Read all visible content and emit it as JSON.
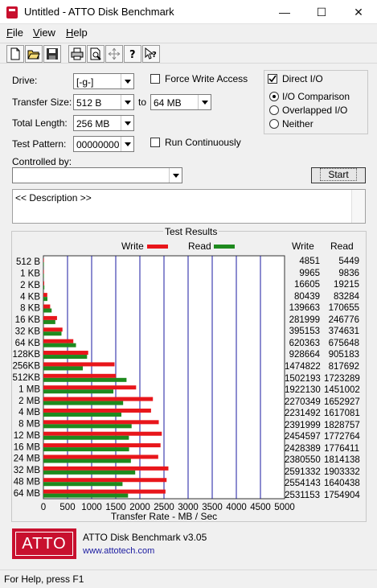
{
  "window": {
    "title": "Untitled - ATTO Disk Benchmark"
  },
  "titlebar_buttons": {
    "minimize": "—",
    "maximize": "☐",
    "close": "✕"
  },
  "menu": [
    "File",
    "View",
    "Help"
  ],
  "toolbar": [
    "new-file-icon",
    "open-folder-icon",
    "save-icon",
    "print-icon",
    "print-preview-icon",
    "move-icon",
    "help-icon",
    "context-help-icon"
  ],
  "settings": {
    "drive_label": "Drive:",
    "drive_value": "[-g-]",
    "transfer_size_label": "Transfer Size:",
    "transfer_from": "512 B",
    "to_label": "to",
    "transfer_to": "64 MB",
    "total_length_label": "Total Length:",
    "total_length_value": "256 MB",
    "test_pattern_label": "Test Pattern:",
    "test_pattern_value": "00000000",
    "controlled_by_label": "Controlled by:",
    "controlled_by_value": "",
    "force_write_access": "Force Write Access",
    "run_continuously": "Run Continuously",
    "direct_io": "Direct I/O",
    "io_comparison": "I/O Comparison",
    "overlapped_io": "Overlapped I/O",
    "neither": "Neither",
    "start_button": "Start",
    "description": "<< Description >>"
  },
  "results": {
    "title": "Test Results",
    "write_label": "Write",
    "read_label": "Read",
    "col_write": "Write",
    "col_read": "Read",
    "rows": [
      {
        "size": "512 B",
        "write": "4851",
        "read": "5449"
      },
      {
        "size": "1 KB",
        "write": "9965",
        "read": "9836"
      },
      {
        "size": "2 KB",
        "write": "16605",
        "read": "19215"
      },
      {
        "size": "4 KB",
        "write": "80439",
        "read": "83284"
      },
      {
        "size": "8 KB",
        "write": "139663",
        "read": "170655"
      },
      {
        "size": "16 KB",
        "write": "281999",
        "read": "246776"
      },
      {
        "size": "32 KB",
        "write": "395153",
        "read": "374631"
      },
      {
        "size": "64 KB",
        "write": "620363",
        "read": "675648"
      },
      {
        "size": "128KB",
        "write": "928664",
        "read": "905183"
      },
      {
        "size": "256KB",
        "write": "1474822",
        "read": "817692"
      },
      {
        "size": "512KB",
        "write": "1502193",
        "read": "1723289"
      },
      {
        "size": "1 MB",
        "write": "1922130",
        "read": "1451002"
      },
      {
        "size": "2 MB",
        "write": "2270349",
        "read": "1652927"
      },
      {
        "size": "4 MB",
        "write": "2231492",
        "read": "1617081"
      },
      {
        "size": "8 MB",
        "write": "2391999",
        "read": "1828757"
      },
      {
        "size": "12 MB",
        "write": "2454597",
        "read": "1772764"
      },
      {
        "size": "16 MB",
        "write": "2428389",
        "read": "1776411"
      },
      {
        "size": "24 MB",
        "write": "2380550",
        "read": "1814138"
      },
      {
        "size": "32 MB",
        "write": "2591332",
        "read": "1903332"
      },
      {
        "size": "48 MB",
        "write": "2554143",
        "read": "1640438"
      },
      {
        "size": "64 MB",
        "write": "2531153",
        "read": "1754904"
      }
    ]
  },
  "chart_data": {
    "type": "bar",
    "orientation": "horizontal",
    "xlabel": "Transfer Rate - MB / Sec",
    "xlim": [
      0,
      5000
    ],
    "xticks": [
      "0",
      "500",
      "1000",
      "1500",
      "2000",
      "2500",
      "3000",
      "3500",
      "4000",
      "4500",
      "5000"
    ],
    "categories": [
      "512 B",
      "1 KB",
      "2 KB",
      "4 KB",
      "8 KB",
      "16 KB",
      "32 KB",
      "64 KB",
      "128KB",
      "256KB",
      "512KB",
      "1 MB",
      "2 MB",
      "4 MB",
      "8 MB",
      "12 MB",
      "16 MB",
      "24 MB",
      "32 MB",
      "48 MB",
      "64 MB"
    ],
    "series": [
      {
        "name": "Write",
        "color": "#e8161b",
        "values": [
          4.85,
          9.97,
          16.6,
          80.4,
          139.7,
          282.0,
          395.2,
          620.4,
          928.7,
          1474.8,
          1502.2,
          1922.1,
          2270.3,
          2231.5,
          2392.0,
          2454.6,
          2428.4,
          2380.6,
          2591.3,
          2554.1,
          2531.2
        ]
      },
      {
        "name": "Read",
        "color": "#1e8a1e",
        "values": [
          5.45,
          9.84,
          19.2,
          83.3,
          170.7,
          246.8,
          374.6,
          675.6,
          905.2,
          817.7,
          1723.3,
          1451.0,
          1652.9,
          1617.1,
          1828.8,
          1772.8,
          1776.4,
          1814.1,
          1903.3,
          1640.4,
          1754.9
        ]
      }
    ],
    "grid": true,
    "grid_color": "#1a1aa0"
  },
  "about": {
    "product": "ATTO Disk Benchmark v3.05",
    "url": "www.attotech.com",
    "logo": "ATTO",
    "logo_color": "#c8102e"
  },
  "status": "For Help, press F1"
}
